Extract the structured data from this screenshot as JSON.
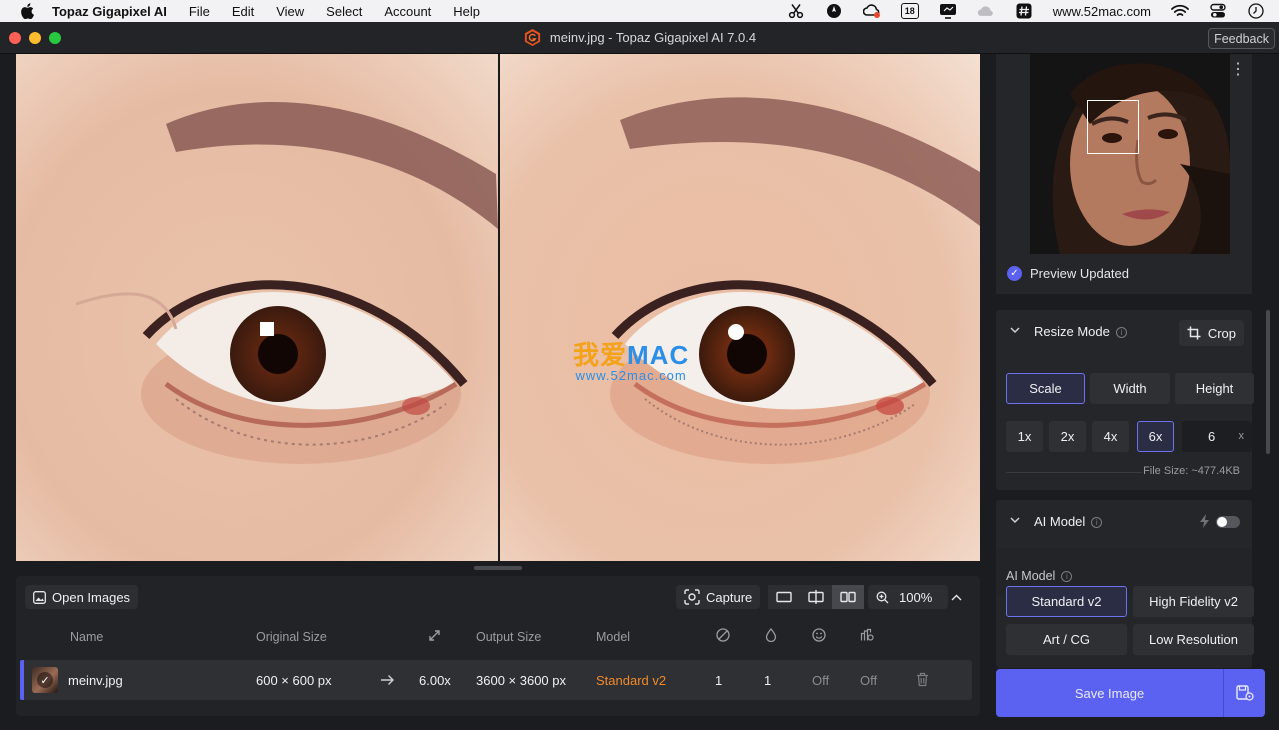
{
  "menubar": {
    "app_name": "Topaz Gigapixel AI",
    "items": [
      "File",
      "Edit",
      "View",
      "Select",
      "Account",
      "Help"
    ],
    "calendar_day": "18",
    "site": "www.52mac.com"
  },
  "window": {
    "title": "meinv.jpg - Topaz Gigapixel AI 7.0.4",
    "feedback_label": "Feedback"
  },
  "preview": {
    "watermark_cn": "我爱",
    "watermark_en": "MAC",
    "watermark_url": "www.52mac.com"
  },
  "queue": {
    "open_images_label": "Open Images",
    "capture_label": "Capture",
    "zoom_level": "100%",
    "columns": {
      "name": "Name",
      "original_size": "Original Size",
      "output_size": "Output Size",
      "model": "Model"
    },
    "rows": [
      {
        "name": "meinv.jpg",
        "original_size": "600 × 600 px",
        "scale": "6.00x",
        "output_size": "3600 × 3600 px",
        "model": "Standard v2",
        "denoise": "1",
        "sharpen": "1",
        "face_recovery": "Off",
        "gamma": "Off"
      }
    ]
  },
  "sidebar": {
    "preview_status": "Preview Updated",
    "resize": {
      "title": "Resize Mode",
      "crop_label": "Crop",
      "modes": [
        "Scale",
        "Width",
        "Height"
      ],
      "selected_mode": "Scale",
      "scales": [
        "1x",
        "2x",
        "4x",
        "6x"
      ],
      "selected_scale": "6x",
      "custom_scale": "6",
      "custom_unit": "x",
      "file_size": "File Size: ~477.4KB"
    },
    "ai_model": {
      "title": "AI Model",
      "auto_enabled": false,
      "sub_label": "AI Model",
      "options": [
        "Standard v2",
        "High Fidelity v2",
        "Art / CG",
        "Low Resolution"
      ],
      "selected": "Standard v2"
    },
    "save_label": "Save Image"
  },
  "colors": {
    "accent": "#5b61f0",
    "model_text": "#f08a2c",
    "background": "#1b1c1f"
  }
}
